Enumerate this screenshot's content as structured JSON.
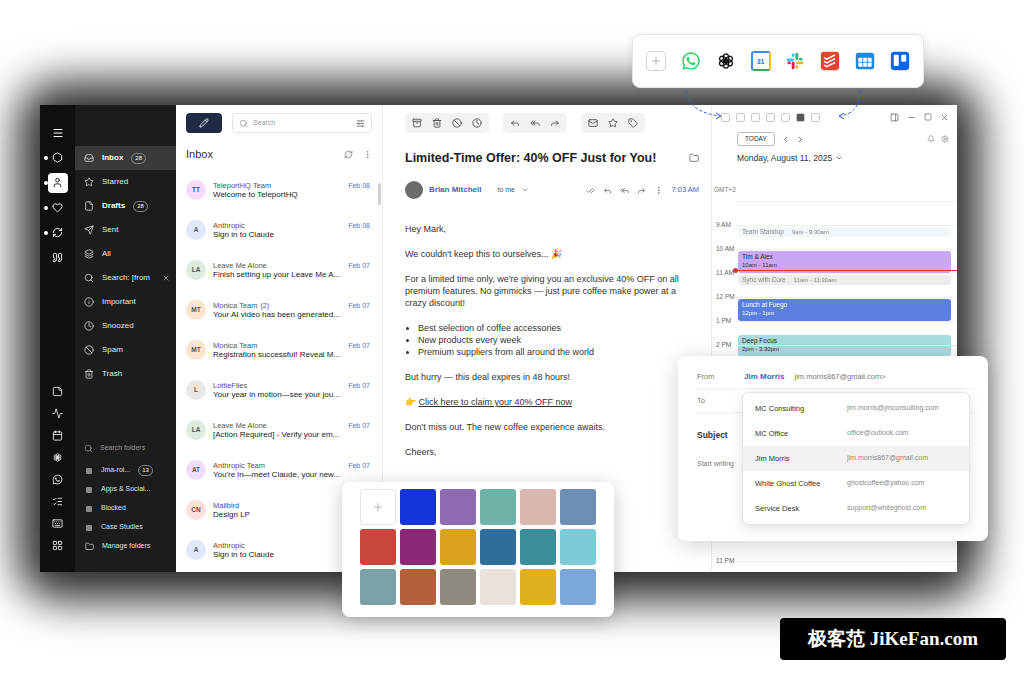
{
  "app_toolbar": {
    "apps": [
      {
        "kind": "add"
      },
      {
        "kind": "whatsapp"
      },
      {
        "kind": "chatgpt"
      },
      {
        "kind": "google-calendar",
        "text": "31"
      },
      {
        "kind": "slack"
      },
      {
        "kind": "todoist"
      },
      {
        "kind": "calendar"
      },
      {
        "kind": "trello"
      }
    ]
  },
  "rail": {
    "accounts": [
      {
        "kind": "hexagon",
        "selected": false,
        "unread": true
      },
      {
        "kind": "user",
        "selected": true,
        "unread": true
      },
      {
        "kind": "heart",
        "selected": false,
        "unread": true
      },
      {
        "kind": "sync",
        "selected": false,
        "unread": true
      },
      {
        "kind": "quote",
        "selected": false,
        "unread": false
      }
    ],
    "apps": [
      {
        "kind": "notes"
      },
      {
        "kind": "activity"
      },
      {
        "kind": "calendar"
      },
      {
        "kind": "chatgpt"
      },
      {
        "kind": "whatsapp"
      },
      {
        "kind": "tasks"
      },
      {
        "kind": "keyboard"
      },
      {
        "kind": "grid"
      }
    ]
  },
  "sidebar": {
    "folders": [
      {
        "label": "Inbox",
        "count": "28",
        "kind": "inbox",
        "selected": true
      },
      {
        "label": "Starred",
        "kind": "star",
        "selected": false
      },
      {
        "label": "Drafts",
        "count": "28",
        "kind": "drafts",
        "selected": false
      },
      {
        "label": "Sent",
        "kind": "sent",
        "selected": false
      },
      {
        "label": "All",
        "kind": "all",
        "selected": false
      },
      {
        "label": "Search: [from",
        "kind": "search",
        "selected": false,
        "closable": true
      },
      {
        "label": "Important",
        "kind": "important",
        "selected": false
      },
      {
        "label": "Snoozed",
        "kind": "snoozed",
        "selected": false
      },
      {
        "label": "Spam",
        "kind": "spam",
        "selected": false
      },
      {
        "label": "Trash",
        "kind": "trash",
        "selected": false
      }
    ],
    "folder_search": {
      "placeholder": "Search folders"
    },
    "custom_folders": [
      {
        "label": "Jma-roi...",
        "count": "13",
        "kind": "folder"
      },
      {
        "label": "Apps & Social...",
        "kind": "folder"
      },
      {
        "label": "Blocked",
        "kind": "folder"
      },
      {
        "label": "Case Studies",
        "kind": "folder"
      },
      {
        "label": "Manage folders",
        "kind": "manage"
      }
    ]
  },
  "mail_list": {
    "search": {
      "placeholder": "Search"
    },
    "title": "Inbox",
    "messages": [
      {
        "initials": "TT",
        "sender": "TeleportHQ Team",
        "date": "Feb 08",
        "subject": "Welcome to TeleportHQ",
        "color": "#f6daf7"
      },
      {
        "initials": "A",
        "sender": "Anthropic",
        "date": "Feb 08",
        "subject": "Sign in to Claude",
        "color": "#e0e7fa"
      },
      {
        "initials": "LA",
        "sender": "Leave Me Alone",
        "date": "Feb 07",
        "subject": "Finish setting up your Leave Me A...",
        "color": "#dcebdf"
      },
      {
        "initials": "MT",
        "sender": "Monica Team",
        "count": "(2)",
        "date": "Feb 07",
        "subject": "Your AI video has been generated...",
        "color": "#fde4cf"
      },
      {
        "initials": "MT",
        "sender": "Monica Team",
        "date": "Feb 07",
        "subject": "Registration successful! Reveal M...",
        "color": "#fde4cf"
      },
      {
        "initials": "L",
        "sender": "LottieFiles",
        "date": "Feb 07",
        "subject": "Your year in motion—see your jou...",
        "color": "#e8e8e8"
      },
      {
        "initials": "LA",
        "sender": "Leave Me Alone",
        "date": "Feb 07",
        "subject": "[Action Required] - Verify your em...",
        "color": "#dcebdf"
      },
      {
        "initials": "AT",
        "sender": "Anthropic Team",
        "date": "Feb 07",
        "subject": "You're in—meet Claude, your new...",
        "color": "#efdefa"
      },
      {
        "initials": "CN",
        "sender": "Mailbird",
        "subject": "Design LP",
        "color": "#fbdede"
      },
      {
        "initials": "A",
        "sender": "Anthropic",
        "subject": "Sign in to Claude",
        "color": "#e0e7fa"
      }
    ]
  },
  "message": {
    "subject": "Limited-Time Offer: 40% OFF Just for You!",
    "sender": "Brian Mitchell",
    "recipient": "to me",
    "time": "7:03 AM",
    "body": [
      {
        "kind": "text",
        "text": "Hey Mark,"
      },
      {
        "kind": "text",
        "text": "We couldn't keep this to ourselves... 🎉"
      },
      {
        "kind": "text",
        "text": "For a limited time only, we're giving you an exclusive 40% OFF on all premium features. No gimmicks — just pure coffee make power at a crazy discount!"
      },
      {
        "kind": "list",
        "items": [
          "Best selection of coffee accessories",
          "New products every week",
          "Premium suppliers from all around the world"
        ]
      },
      {
        "kind": "text",
        "text": "But hurry — this deal expires in 48 hours!"
      },
      {
        "kind": "link",
        "prefix": "👉",
        "text": "Click here to claim your 40% OFF now"
      },
      {
        "kind": "text",
        "text": "Don't miss out. The new coffee experience awaits."
      },
      {
        "kind": "text",
        "text": "Cheers,"
      }
    ]
  },
  "calendar": {
    "today": "TODAY",
    "date": "Monday, August 11, 2025",
    "timezone": "GMT+2",
    "hours": [
      {
        "label": "",
        "now": false,
        "events": []
      },
      {
        "label": "9 AM",
        "now": false,
        "events": [
          {
            "title": "Team Standup",
            "time": "9am - 9:30am",
            "color": "#e9f1f8",
            "faded": true,
            "offset": 0,
            "duration": 0.5
          }
        ]
      },
      {
        "label": "10 AM",
        "now": true,
        "events": [
          {
            "title": "Tim & Alex",
            "time": "10am - 11am",
            "color": "#c9a7f3",
            "faded": false,
            "offset": 0,
            "duration": 1
          }
        ]
      },
      {
        "label": "11 AM",
        "now": false,
        "events": [
          {
            "title": "Sync with Core",
            "time": "11am - 11:30am",
            "color": "#e2e2e2",
            "faded": true,
            "offset": 0,
            "duration": 0.5
          }
        ]
      },
      {
        "label": "12 PM",
        "now": false,
        "events": [
          {
            "title": "Lunch at Fuego",
            "time": "12pm - 1pm",
            "color": "#5b7fe0",
            "faded": false,
            "offset": 0,
            "duration": 1
          }
        ]
      },
      {
        "label": "1 PM",
        "now": false,
        "events": [
          {
            "title": "Deep Focus",
            "time": "2pm - 3:30pm",
            "color": "#a6dde1",
            "faded": false,
            "offset": 0.5,
            "duration": 1
          }
        ]
      },
      {
        "label": "2 PM",
        "now": false,
        "events": []
      },
      {
        "label": "",
        "now": false,
        "events": []
      },
      {
        "label": "",
        "now": false,
        "events": []
      },
      {
        "label": "",
        "now": false,
        "events": []
      },
      {
        "label": "",
        "now": false,
        "events": []
      },
      {
        "label": "",
        "now": false,
        "events": []
      },
      {
        "label": "",
        "now": false,
        "events": []
      },
      {
        "label": "",
        "now": false,
        "events": []
      },
      {
        "label": "",
        "now": false,
        "events": []
      },
      {
        "label": "11 PM",
        "now": false,
        "events": []
      }
    ]
  },
  "compose": {
    "from_label": "From",
    "from_name": "Jim Morris",
    "from_email": "jim.morris867@gmail.com>",
    "to_label": "To",
    "subject_label": "Subject",
    "body_placeholder": "Start writing",
    "contacts": [
      {
        "name": "MC Consulting",
        "email": "jim.morris@jmconsulting.com",
        "selected": false
      },
      {
        "name": "MC Office",
        "email": "office@outlook.com",
        "selected": false
      },
      {
        "name": "Jim Morris",
        "email": "jim.morris867@gmail.com",
        "selected": true
      },
      {
        "name": "White Ghost Coffee",
        "email": "ghostcoffee@yahoo.com",
        "selected": false
      },
      {
        "name": "Service Desk",
        "email": "support@whiteghost.com",
        "selected": false
      }
    ]
  },
  "image_picker": {
    "tiles": [
      {
        "kind": "add"
      },
      {
        "kind": "swatch",
        "color": "#1434d8"
      },
      {
        "kind": "photo",
        "color": "#8e6bb0"
      },
      {
        "kind": "photo",
        "color": "#6fb3a8"
      },
      {
        "kind": "photo",
        "color": "#d9b7ae"
      },
      {
        "kind": "photo",
        "color": "#6d8fb5"
      },
      {
        "kind": "photo",
        "color": "#c9463d"
      },
      {
        "kind": "photo",
        "color": "#8a2a77"
      },
      {
        "kind": "photo",
        "color": "#d9a21f"
      },
      {
        "kind": "photo",
        "color": "#2f6e9a"
      },
      {
        "kind": "photo",
        "color": "#3d8e9c"
      },
      {
        "kind": "photo",
        "color": "#7dcbd6"
      },
      {
        "kind": "photo",
        "color": "#7ba0a6"
      },
      {
        "kind": "photo",
        "color": "#b2613a"
      },
      {
        "kind": "photo",
        "color": "#8e8a80"
      },
      {
        "kind": "photo",
        "color": "#e9e2dc"
      },
      {
        "kind": "photo",
        "color": "#e0b020"
      },
      {
        "kind": "photo",
        "color": "#7aa8d8"
      }
    ]
  },
  "watermark": {
    "text": "极客范 JiKeFan.com"
  }
}
